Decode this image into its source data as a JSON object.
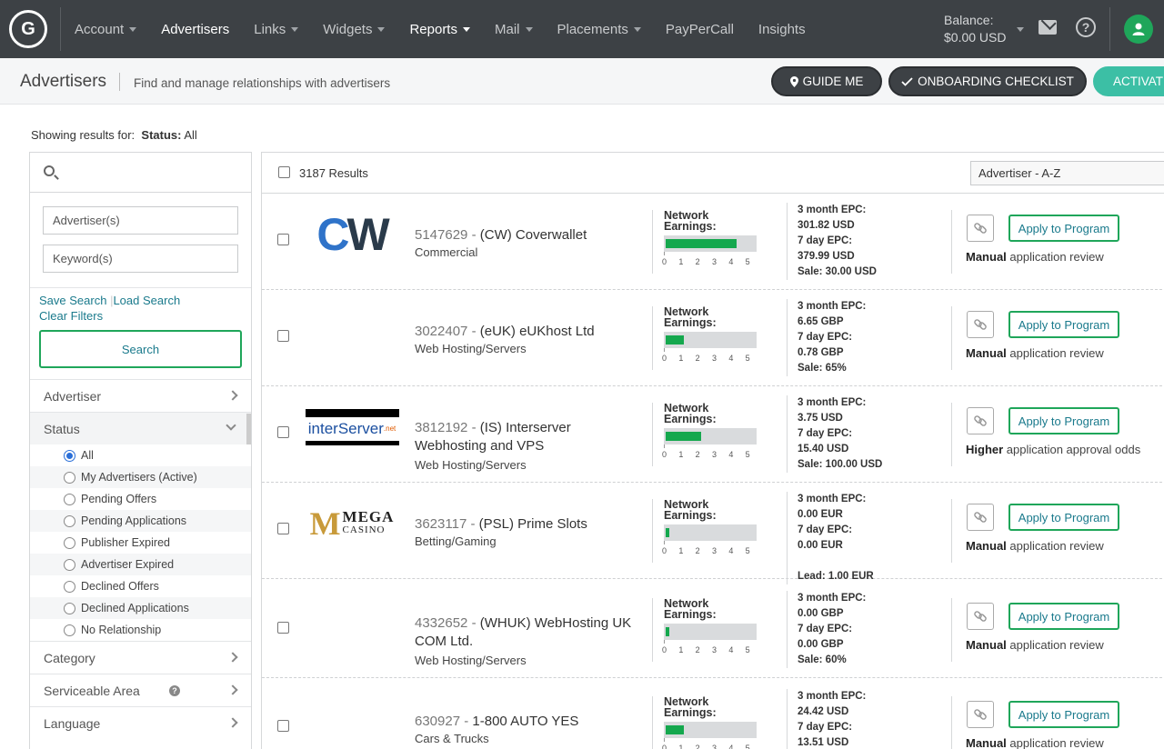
{
  "nav": {
    "logo": "G",
    "items": [
      {
        "label": "Account",
        "caret": true,
        "active": false
      },
      {
        "label": "Advertisers",
        "caret": false,
        "active": true
      },
      {
        "label": "Links",
        "caret": true,
        "active": false
      },
      {
        "label": "Widgets",
        "caret": true,
        "active": false
      },
      {
        "label": "Reports",
        "caret": true,
        "active": true
      },
      {
        "label": "Mail",
        "caret": true,
        "active": false
      },
      {
        "label": "Placements",
        "caret": true,
        "active": false
      },
      {
        "label": "PayPerCall",
        "caret": false,
        "active": false
      },
      {
        "label": "Insights",
        "caret": false,
        "active": false
      }
    ],
    "balance_label": "Balance:",
    "balance_value": "$0.00 USD",
    "help_glyph": "?"
  },
  "header": {
    "title": "Advertisers",
    "subtitle": "Find and manage relationships with advertisers",
    "guide_me": "GUIDE ME",
    "onboarding": "ONBOARDING CHECKLIST",
    "activate": "ACTIVATE"
  },
  "showing": {
    "prefix": "Showing results for:",
    "status_label": "Status:",
    "status_value": "All"
  },
  "sidebar": {
    "advertiser_placeholder": "Advertiser(s)",
    "keyword_placeholder": "Keyword(s)",
    "save_search": "Save Search",
    "load_search": "Load Search",
    "clear_filters": "Clear Filters",
    "search_button": "Search",
    "facets": {
      "advertiser": "Advertiser",
      "status": "Status",
      "category": "Category",
      "serviceable_area": "Serviceable Area",
      "language": "Language"
    },
    "status_options": [
      {
        "label": "All",
        "checked": true
      },
      {
        "label": "My Advertisers (Active)",
        "checked": false
      },
      {
        "label": "Pending Offers",
        "checked": false
      },
      {
        "label": "Pending Applications",
        "checked": false
      },
      {
        "label": "Publisher Expired",
        "checked": false
      },
      {
        "label": "Advertiser Expired",
        "checked": false
      },
      {
        "label": "Declined Offers",
        "checked": false
      },
      {
        "label": "Declined Applications",
        "checked": false
      },
      {
        "label": "No Relationship",
        "checked": false
      }
    ]
  },
  "results": {
    "count": "3187 Results",
    "sort": "Advertiser - A-Z",
    "network_earnings_label_1": "Network",
    "network_earnings_label_2": "Earnings:",
    "scale": [
      "0",
      "1",
      "2",
      "3",
      "4",
      "5"
    ],
    "apply_label": "Apply to Program",
    "rows": [
      {
        "id": "5147629",
        "name": "(CW) Coverwallet",
        "category": "Commercial",
        "logo": "cw",
        "earnings": 4.0,
        "epc": [
          "3 month EPC:",
          "301.82 USD",
          "7 day EPC:",
          "379.99 USD",
          "Sale: 30.00 USD"
        ],
        "review_bold": "Manual",
        "review_rest": " application review"
      },
      {
        "id": "3022407",
        "name": "(eUK) eUKhost Ltd",
        "category": "Web Hosting/Servers",
        "logo": "",
        "earnings": 1.0,
        "epc": [
          "3 month EPC:",
          "6.65 GBP",
          "7 day EPC:",
          "0.78 GBP",
          "Sale: 65%"
        ],
        "review_bold": "Manual",
        "review_rest": " application review"
      },
      {
        "id": "3812192",
        "name": "(IS) Interserver Webhosting and VPS",
        "category": "Web Hosting/Servers",
        "logo": "interserver",
        "earnings": 2.0,
        "epc": [
          "3 month EPC:",
          "3.75 USD",
          "7 day EPC:",
          "15.40 USD",
          "Sale: 100.00 USD"
        ],
        "review_bold": "Higher",
        "review_rest": " application approval odds"
      },
      {
        "id": "3623117",
        "name": "(PSL) Prime Slots",
        "category": "Betting/Gaming",
        "logo": "mega",
        "earnings": 0.2,
        "epc": [
          "3 month EPC:",
          "0.00 EUR",
          "7 day EPC:",
          "0.00 EUR",
          "",
          "Lead: 1.00 EUR"
        ],
        "review_bold": "Manual",
        "review_rest": " application review"
      },
      {
        "id": "4332652",
        "name": "(WHUK) WebHosting UK COM Ltd.",
        "category": "Web Hosting/Servers",
        "logo": "",
        "earnings": 0.2,
        "epc": [
          "3 month EPC:",
          "0.00 GBP",
          "7 day EPC:",
          "0.00 GBP",
          "Sale: 60%"
        ],
        "review_bold": "Manual",
        "review_rest": " application review"
      },
      {
        "id": "630927",
        "name": "1-800 AUTO YES",
        "category": "Cars & Trucks",
        "logo": "",
        "earnings": 1.0,
        "epc": [
          "3 month EPC:",
          "24.42 USD",
          "7 day EPC:",
          "13.51 USD"
        ],
        "review_bold": "Manual",
        "review_rest": " application review"
      }
    ]
  },
  "logos": {
    "cw": "CW",
    "interserver": "interServer",
    "interserver_suffix": ".net",
    "mega_top": "MEGA",
    "mega_bottom": "CASINO"
  }
}
